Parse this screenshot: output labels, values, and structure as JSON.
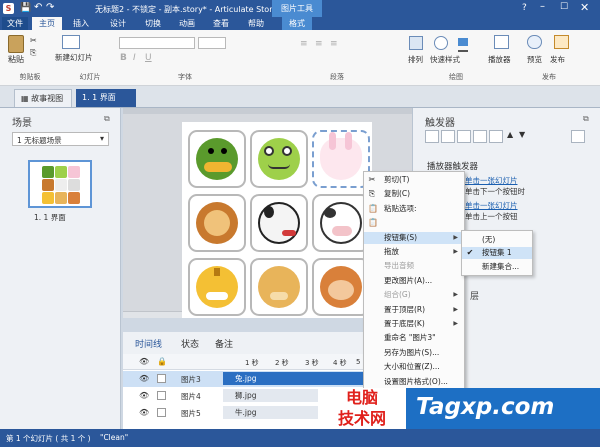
{
  "titlebar": {
    "title": "无标题2 - 不锁定 - 副本.story* - Articulate Storyline 2",
    "picture_tools": "图片工具"
  },
  "ribbon_tabs": [
    {
      "label": "文件"
    },
    {
      "label": "主页"
    },
    {
      "label": "插入"
    },
    {
      "label": "设计"
    },
    {
      "label": "切换"
    },
    {
      "label": "动画"
    },
    {
      "label": "查看"
    },
    {
      "label": "帮助"
    },
    {
      "label": "格式"
    }
  ],
  "ribbon": {
    "paste": "粘贴",
    "clipboard": "剪贴板",
    "new_slide": "新建幻灯片",
    "slides": "幻灯片",
    "font": "字体",
    "paragraph": "段落",
    "arrange": "排列",
    "quick_styles": "快速样式",
    "drawing": "绘图",
    "player": "播放器",
    "preview": "预览",
    "publish": "发布",
    "publish_group": "发布"
  },
  "story_tabs": [
    {
      "label": "故事视图"
    },
    {
      "label": "1. 1 界面"
    }
  ],
  "scenes": {
    "title": "场景",
    "dropdown": "1 无标题场景",
    "slide_label": "1. 1 界面"
  },
  "triggers": {
    "title": "触发器",
    "player_triggers": "播放器触发器",
    "rows": [
      "单击一张幻灯片",
      "单击下一个按钮时",
      "单击一张幻灯片",
      "单击上一个按钮"
    ],
    "layers_title": "层"
  },
  "context_menu": {
    "items": [
      {
        "label": "剪切(T)",
        "icon": "✂",
        "disabled": false
      },
      {
        "label": "复制(C)",
        "icon": "⎘",
        "disabled": false
      },
      {
        "label": "粘贴选项:",
        "icon": "📋",
        "disabled": false
      },
      {
        "label": "",
        "icon": "📋",
        "disabled": false
      },
      {
        "label": "按钮集(S)",
        "icon": "",
        "disabled": false,
        "highlight": true,
        "submenu": true
      },
      {
        "label": "拖放",
        "icon": "",
        "disabled": false,
        "submenu": true
      },
      {
        "label": "导出音频",
        "icon": "",
        "disabled": true
      },
      {
        "label": "更改图片(A)...",
        "icon": "",
        "disabled": false
      },
      {
        "label": "组合(G)",
        "icon": "",
        "disabled": true,
        "submenu": true
      },
      {
        "label": "置于顶层(R)",
        "icon": "",
        "disabled": false,
        "submenu": true
      },
      {
        "label": "置于底层(K)",
        "icon": "",
        "disabled": false,
        "submenu": true
      },
      {
        "label": "重命名 \"图片3\"",
        "icon": "",
        "disabled": false
      },
      {
        "label": "另存为图片(S)...",
        "icon": "",
        "disabled": false
      },
      {
        "label": "大小和位置(Z)...",
        "icon": "",
        "disabled": false
      },
      {
        "label": "设置图片格式(O)...",
        "icon": "",
        "disabled": false
      }
    ]
  },
  "submenu": {
    "items": [
      {
        "label": "(无)",
        "checked": false
      },
      {
        "label": "按钮集 1",
        "checked": true
      },
      {
        "label": "新建集合...",
        "checked": false
      }
    ]
  },
  "timeline": {
    "tabs": [
      "时间线",
      "状态",
      "备注"
    ],
    "ticks": [
      "1 秒",
      "2 秒",
      "3 秒",
      "4 秒",
      "5"
    ],
    "rows": [
      {
        "name": "图片3",
        "clip": "兔.jpg"
      },
      {
        "name": "图片4",
        "clip": "狮.jpg"
      },
      {
        "name": "图片5",
        "clip": "牛.jpg"
      }
    ]
  },
  "statusbar": {
    "text": "第 1 个幻灯片 ( 共 1 个 )",
    "theme": "\"Clean\""
  },
  "watermark": {
    "brand": "电脑",
    "brand2": "技术网",
    "url": "Tagxp.com"
  },
  "colors": {
    "accent": "#2b579a",
    "picture_tools": "#4a8bd1"
  }
}
